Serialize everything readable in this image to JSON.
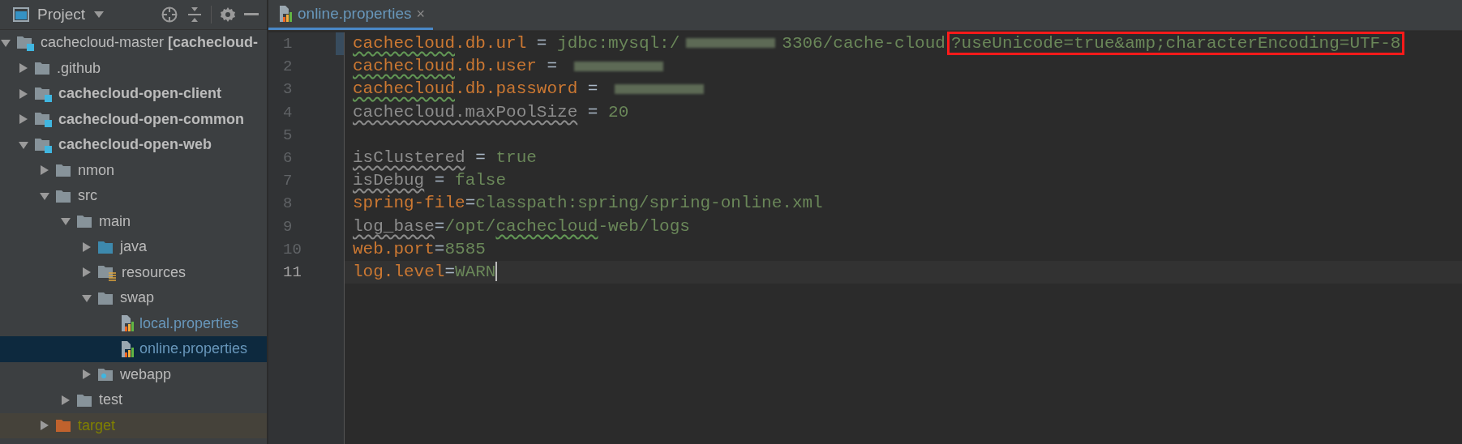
{
  "sidebar": {
    "title": "Project",
    "tree": [
      {
        "label": "cachecloud-master **[cachecloud-**",
        "kind": "module",
        "bold": false,
        "expanded": true,
        "selected": false,
        "modified": false,
        "excluded": false,
        "children": [
          {
            "label": ".github",
            "kind": "folder",
            "bold": false,
            "expanded": false,
            "selected": false,
            "modified": false,
            "excluded": false
          },
          {
            "label": "cachecloud-open-client",
            "kind": "module",
            "bold": true,
            "expanded": false,
            "selected": false,
            "modified": false,
            "excluded": false
          },
          {
            "label": "cachecloud-open-common",
            "kind": "module",
            "bold": true,
            "expanded": false,
            "selected": false,
            "modified": false,
            "excluded": false
          },
          {
            "label": "cachecloud-open-web",
            "kind": "module",
            "bold": true,
            "expanded": true,
            "selected": false,
            "modified": false,
            "excluded": false,
            "children": [
              {
                "label": "nmon",
                "kind": "folder",
                "bold": false,
                "expanded": false,
                "selected": false,
                "modified": false,
                "excluded": false
              },
              {
                "label": "src",
                "kind": "folder",
                "bold": false,
                "expanded": true,
                "selected": false,
                "modified": false,
                "excluded": false,
                "children": [
                  {
                    "label": "main",
                    "kind": "folder",
                    "bold": false,
                    "expanded": true,
                    "selected": false,
                    "modified": false,
                    "excluded": false,
                    "children": [
                      {
                        "label": "java",
                        "kind": "source-folder",
                        "bold": false,
                        "expanded": false,
                        "selected": false,
                        "modified": false,
                        "excluded": false
                      },
                      {
                        "label": "resources",
                        "kind": "resource-folder",
                        "bold": false,
                        "expanded": false,
                        "selected": false,
                        "modified": false,
                        "excluded": false
                      },
                      {
                        "label": "swap",
                        "kind": "folder",
                        "bold": false,
                        "expanded": true,
                        "selected": false,
                        "modified": false,
                        "excluded": false,
                        "children": [
                          {
                            "label": "local.properties",
                            "kind": "properties-file",
                            "bold": false,
                            "selected": false,
                            "modified": true,
                            "excluded": false
                          },
                          {
                            "label": "online.properties",
                            "kind": "properties-file",
                            "bold": false,
                            "selected": true,
                            "modified": true,
                            "excluded": false
                          }
                        ]
                      },
                      {
                        "label": "webapp",
                        "kind": "web-folder",
                        "bold": false,
                        "expanded": false,
                        "selected": false,
                        "modified": false,
                        "excluded": false
                      }
                    ]
                  },
                  {
                    "label": "test",
                    "kind": "folder",
                    "bold": false,
                    "expanded": false,
                    "selected": false,
                    "modified": false,
                    "excluded": false
                  }
                ]
              },
              {
                "label": "target",
                "kind": "excluded-folder",
                "bold": false,
                "expanded": false,
                "selected": false,
                "modified": false,
                "excluded": true
              }
            ]
          }
        ]
      }
    ]
  },
  "editor": {
    "tabs": [
      {
        "label": "online.properties",
        "close": "×",
        "selected": true
      }
    ],
    "lines": [
      {
        "number": "1",
        "current": false,
        "changed": true,
        "segments": [
          {
            "text": "cachecloud",
            "kind": "key",
            "typo": true,
            "boxed": false
          },
          {
            "text": ".db.url",
            "kind": "key",
            "typo": false,
            "boxed": false
          },
          {
            "text": " = ",
            "kind": "op",
            "typo": false,
            "boxed": false
          },
          {
            "text": "jdbc:mysql:/",
            "kind": "value",
            "typo": false,
            "boxed": false
          },
          {
            "kind": "redacted"
          },
          {
            "text": "3306/cache-cloud",
            "kind": "value",
            "typo": false,
            "boxed": false
          },
          {
            "text": "?useUnicode=true&amp;characterEncoding=UTF-8",
            "kind": "value",
            "typo": false,
            "boxed": true
          }
        ]
      },
      {
        "number": "2",
        "current": false,
        "changed": false,
        "segments": [
          {
            "text": "cachecloud",
            "kind": "key",
            "typo": true,
            "boxed": false
          },
          {
            "text": ".db.user",
            "kind": "key",
            "typo": false,
            "boxed": false
          },
          {
            "text": " = ",
            "kind": "op",
            "typo": false,
            "boxed": false
          },
          {
            "kind": "redacted"
          }
        ]
      },
      {
        "number": "3",
        "current": false,
        "changed": false,
        "segments": [
          {
            "text": "cachecloud",
            "kind": "key",
            "typo": true,
            "boxed": false
          },
          {
            "text": ".db.password",
            "kind": "key",
            "typo": false,
            "boxed": false
          },
          {
            "text": " = ",
            "kind": "op",
            "typo": false,
            "boxed": false
          },
          {
            "kind": "redacted"
          }
        ]
      },
      {
        "number": "4",
        "current": false,
        "changed": false,
        "segments": [
          {
            "text": "cachecloud.maxPoolSize",
            "kind": "unused",
            "typo": true,
            "boxed": false
          },
          {
            "text": " = ",
            "kind": "op",
            "typo": false,
            "boxed": false
          },
          {
            "text": "20",
            "kind": "value",
            "typo": false,
            "boxed": false
          }
        ]
      },
      {
        "number": "5",
        "current": false,
        "changed": false
      },
      {
        "number": "6",
        "current": false,
        "changed": false,
        "segments": [
          {
            "text": "isClustered",
            "kind": "unused",
            "typo": true,
            "boxed": false
          },
          {
            "text": " = ",
            "kind": "op",
            "typo": false,
            "boxed": false
          },
          {
            "text": "true",
            "kind": "value",
            "typo": false,
            "boxed": false
          }
        ]
      },
      {
        "number": "7",
        "current": false,
        "changed": false,
        "segments": [
          {
            "text": "isDebug",
            "kind": "unused",
            "typo": true,
            "boxed": false
          },
          {
            "text": " = ",
            "kind": "op",
            "typo": false,
            "boxed": false
          },
          {
            "text": "false",
            "kind": "value",
            "typo": false,
            "boxed": false
          }
        ]
      },
      {
        "number": "8",
        "current": false,
        "changed": false,
        "segments": [
          {
            "text": "spring-file",
            "kind": "key",
            "typo": false,
            "boxed": false
          },
          {
            "text": "=",
            "kind": "op",
            "typo": false,
            "boxed": false
          },
          {
            "text": "classpath:spring/spring-online.xml",
            "kind": "value",
            "typo": false,
            "boxed": false
          }
        ]
      },
      {
        "number": "9",
        "current": false,
        "changed": false,
        "segments": [
          {
            "text": "log_base",
            "kind": "unused",
            "typo": true,
            "boxed": false
          },
          {
            "text": "=",
            "kind": "op",
            "typo": false,
            "boxed": false
          },
          {
            "text": "/opt/",
            "kind": "value",
            "typo": false,
            "boxed": false
          },
          {
            "text": "cachecloud",
            "kind": "value",
            "typo": true,
            "boxed": false
          },
          {
            "text": "-web/logs",
            "kind": "value",
            "typo": false,
            "boxed": false
          }
        ]
      },
      {
        "number": "10",
        "current": false,
        "changed": false,
        "segments": [
          {
            "text": "web.port",
            "kind": "key",
            "typo": false,
            "boxed": false
          },
          {
            "text": "=",
            "kind": "op",
            "typo": false,
            "boxed": false
          },
          {
            "text": "8585",
            "kind": "value",
            "typo": false,
            "boxed": false
          }
        ]
      },
      {
        "number": "11",
        "current": true,
        "changed": false,
        "segments": [
          {
            "text": "log.level",
            "kind": "key",
            "typo": false,
            "boxed": false
          },
          {
            "text": "=",
            "kind": "op",
            "typo": false,
            "boxed": false
          },
          {
            "text": "WARN",
            "kind": "value",
            "typo": false,
            "boxed": false
          }
        ]
      }
    ]
  }
}
